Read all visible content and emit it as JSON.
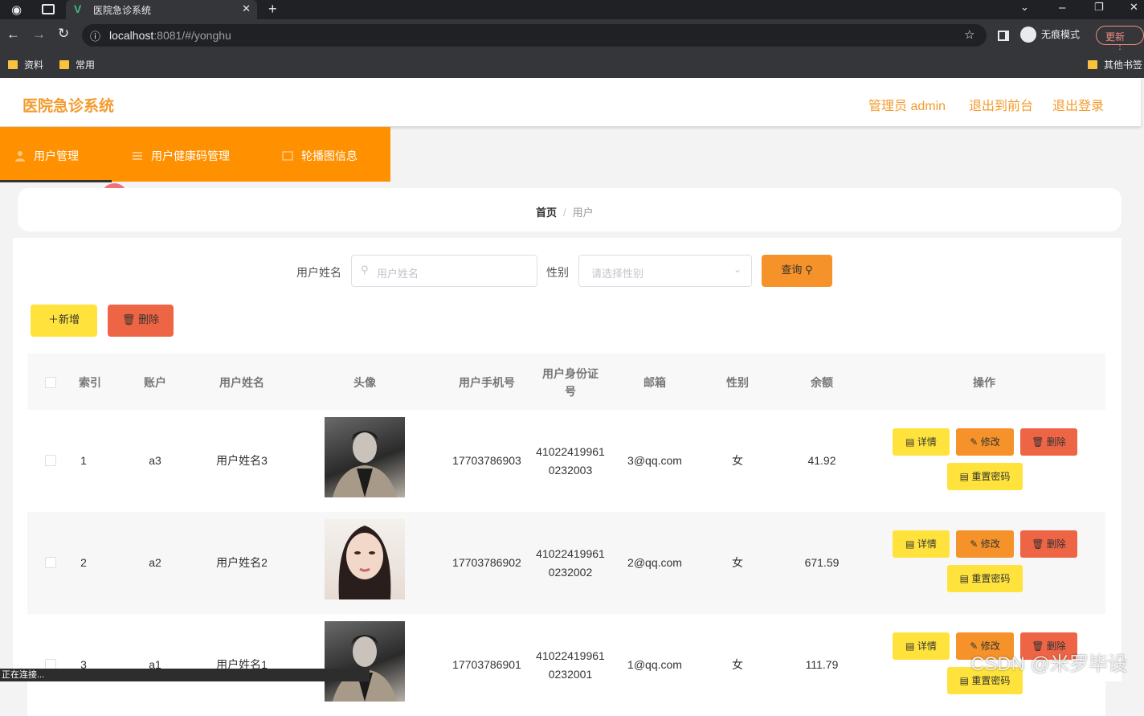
{
  "browser": {
    "tab_title": "医院急诊系统",
    "url_host": "localhost",
    "url_path": ":8081/#/yonghu",
    "incognito_label": "无痕模式",
    "update_label": "更新",
    "bookmarks": [
      "资料",
      "常用"
    ],
    "other_bookmarks": "其他书签",
    "status": "正在连接..."
  },
  "header": {
    "title": "医院急诊系统",
    "admin": "管理员 admin",
    "exit_front": "退出到前台",
    "logout": "退出登录"
  },
  "nav": {
    "items": [
      {
        "label": "用户管理"
      },
      {
        "label": "用户健康码管理"
      },
      {
        "label": "轮播图信息"
      }
    ]
  },
  "breadcrumb": {
    "home": "首页",
    "current": "用户"
  },
  "search": {
    "name_label": "用户姓名",
    "name_placeholder": "用户姓名",
    "gender_label": "性别",
    "gender_placeholder": "请选择性别",
    "query_button": "查询"
  },
  "actions": {
    "add": "新增",
    "delete": "删除"
  },
  "table": {
    "headers": [
      "索引",
      "账户",
      "用户姓名",
      "头像",
      "用户手机号",
      "用户身份证号",
      "邮箱",
      "性别",
      "余额",
      "操作"
    ],
    "rows": [
      {
        "index": "1",
        "account": "a3",
        "name": "用户姓名3",
        "phone": "17703786903",
        "id_card": "410224199610232003",
        "email": "3@qq.com",
        "gender": "女",
        "balance": "41.92"
      },
      {
        "index": "2",
        "account": "a2",
        "name": "用户姓名2",
        "phone": "17703786902",
        "id_card": "410224199610232002",
        "email": "2@qq.com",
        "gender": "女",
        "balance": "671.59"
      },
      {
        "index": "3",
        "account": "a1",
        "name": "用户姓名1",
        "phone": "17703786901",
        "id_card": "410224199610232001",
        "email": "1@qq.com",
        "gender": "女",
        "balance": "111.79"
      }
    ],
    "op_labels": {
      "detail": "详情",
      "edit": "修改",
      "delete": "删除",
      "reset_password": "重置密码"
    }
  },
  "watermark": "CSDN @米罗毕设",
  "colors": {
    "accent": "#ff9000",
    "title": "#f39b2d",
    "yellow_btn": "#ffe33c",
    "orange_btn": "#f5922a",
    "red_btn": "#ee6545"
  }
}
